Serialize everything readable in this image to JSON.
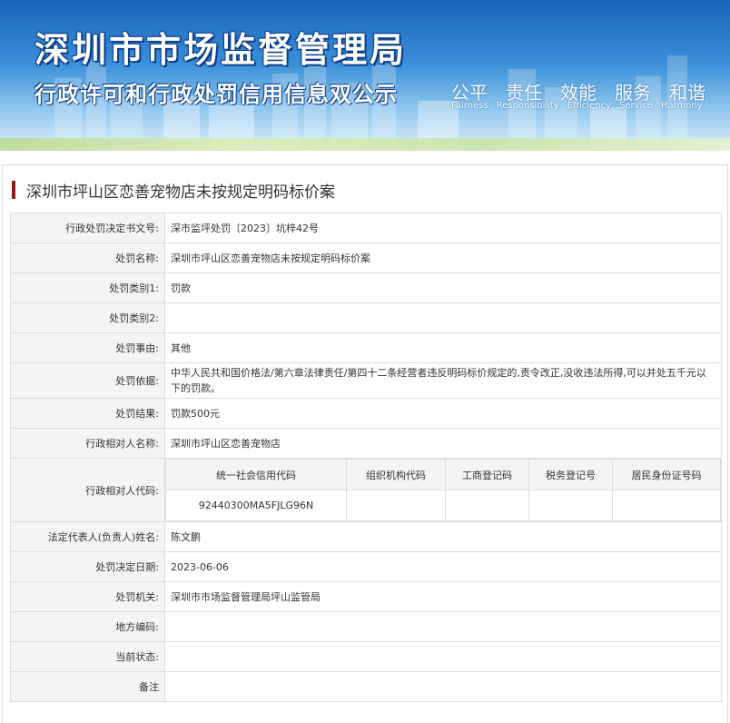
{
  "banner": {
    "title_main": "深圳市市场监督管理局",
    "title_sub": "行政许可和行政处罚信用信息双公示",
    "slogans_cn": [
      "公平",
      "责任",
      "效能",
      "服务",
      "和谐"
    ],
    "slogans_en": [
      "Fairness",
      "Responsibility",
      "Efficiency",
      "Service",
      "Harmony"
    ]
  },
  "case_title": "深圳市坪山区恋善宠物店未按规定明码标价案",
  "rows": [
    {
      "label": "行政处罚决定书文号:",
      "value": "深市监坪处罚〔2023〕坑梓42号"
    },
    {
      "label": "处罚名称:",
      "value": "深圳市坪山区恋善宠物店未按规定明码标价案"
    },
    {
      "label": "处罚类别1:",
      "value": "罚款"
    },
    {
      "label": "处罚类别2:",
      "value": ""
    },
    {
      "label": "处罚事由:",
      "value": "其他"
    },
    {
      "label": "处罚依据:",
      "value": "中华人民共和国价格法/第六章法律责任/第四十二条经营者违反明码标价规定的,责令改正,没收违法所得,可以并处五千元以下的罚款。"
    },
    {
      "label": "处罚结果:",
      "value": "罚款500元"
    },
    {
      "label": "行政相对人名称:",
      "value": "深圳市坪山区恋善宠物店"
    }
  ],
  "code_row": {
    "label": "行政相对人代码:",
    "headers": [
      "统一社会信用代码",
      "组织机构代码",
      "工商登记码",
      "税务登记号",
      "居民身份证号码"
    ],
    "values": [
      "92440300MA5FJLG96N",
      "",
      "",
      "",
      ""
    ]
  },
  "rows2": [
    {
      "label": "法定代表人(负责人)姓名:",
      "value": "陈文鹏"
    },
    {
      "label": "处罚决定日期:",
      "value": "2023-06-06"
    },
    {
      "label": "处罚机关:",
      "value": "深圳市市场监督管理局坪山监管局"
    },
    {
      "label": "地方编码:",
      "value": ""
    },
    {
      "label": "当前状态:",
      "value": ""
    },
    {
      "label": "备注",
      "value": ""
    }
  ]
}
